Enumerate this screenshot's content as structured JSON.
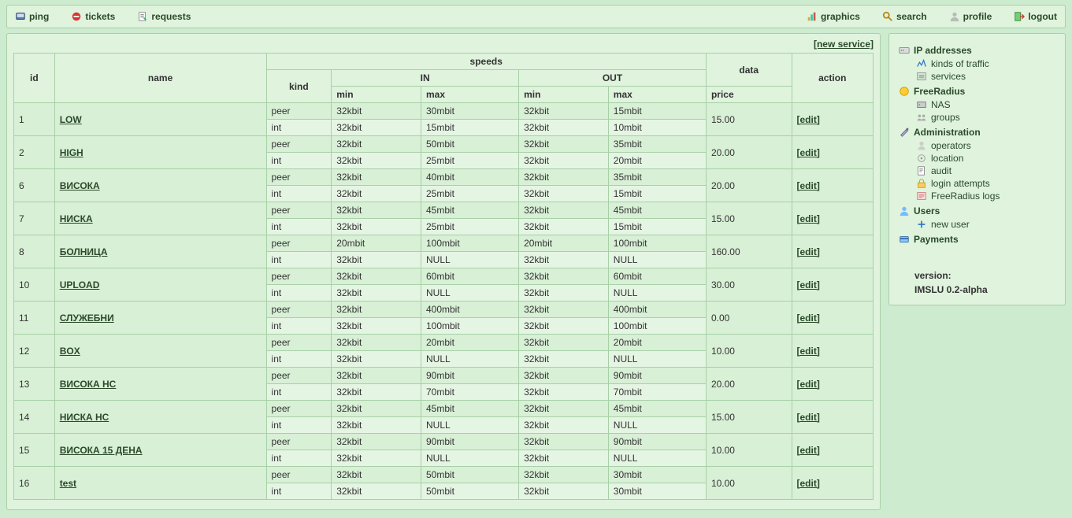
{
  "topnav": {
    "left": [
      {
        "label": "ping",
        "icon": "ping-icon"
      },
      {
        "label": "tickets",
        "icon": "tickets-icon"
      },
      {
        "label": "requests",
        "icon": "requests-icon"
      }
    ],
    "right": [
      {
        "label": "graphics",
        "icon": "graphics-icon"
      },
      {
        "label": "search",
        "icon": "search-icon"
      },
      {
        "label": "profile",
        "icon": "profile-icon"
      },
      {
        "label": "logout",
        "icon": "logout-icon"
      }
    ]
  },
  "new_service_label": "[new service]",
  "edit_label": "[edit]",
  "table": {
    "headers": {
      "id": "id",
      "name": "name",
      "speeds": "speeds",
      "kind": "kind",
      "in": "IN",
      "out": "OUT",
      "min": "min",
      "max": "max",
      "data": "data",
      "price": "price",
      "action": "action"
    },
    "kind_labels": {
      "peer": "peer",
      "int": "int"
    },
    "rows": [
      {
        "id": "1",
        "name": "LOW",
        "peer": {
          "in_min": "32kbit",
          "in_max": "30mbit",
          "out_min": "32kbit",
          "out_max": "15mbit"
        },
        "int": {
          "in_min": "32kbit",
          "in_max": "15mbit",
          "out_min": "32kbit",
          "out_max": "10mbit"
        },
        "price": "15.00"
      },
      {
        "id": "2",
        "name": "HIGH",
        "peer": {
          "in_min": "32kbit",
          "in_max": "50mbit",
          "out_min": "32kbit",
          "out_max": "35mbit"
        },
        "int": {
          "in_min": "32kbit",
          "in_max": "25mbit",
          "out_min": "32kbit",
          "out_max": "20mbit"
        },
        "price": "20.00"
      },
      {
        "id": "6",
        "name": "ВИСОКА",
        "peer": {
          "in_min": "32kbit",
          "in_max": "40mbit",
          "out_min": "32kbit",
          "out_max": "35mbit"
        },
        "int": {
          "in_min": "32kbit",
          "in_max": "25mbit",
          "out_min": "32kbit",
          "out_max": "15mbit"
        },
        "price": "20.00"
      },
      {
        "id": "7",
        "name": "НИСКА",
        "peer": {
          "in_min": "32kbit",
          "in_max": "45mbit",
          "out_min": "32kbit",
          "out_max": "45mbit"
        },
        "int": {
          "in_min": "32kbit",
          "in_max": "25mbit",
          "out_min": "32kbit",
          "out_max": "15mbit"
        },
        "price": "15.00"
      },
      {
        "id": "8",
        "name": "БОЛНИЦА",
        "peer": {
          "in_min": "20mbit",
          "in_max": "100mbit",
          "out_min": "20mbit",
          "out_max": "100mbit"
        },
        "int": {
          "in_min": "32kbit",
          "in_max": "NULL",
          "out_min": "32kbit",
          "out_max": "NULL"
        },
        "price": "160.00"
      },
      {
        "id": "10",
        "name": "UPLOAD",
        "peer": {
          "in_min": "32kbit",
          "in_max": "60mbit",
          "out_min": "32kbit",
          "out_max": "60mbit"
        },
        "int": {
          "in_min": "32kbit",
          "in_max": "NULL",
          "out_min": "32kbit",
          "out_max": "NULL"
        },
        "price": "30.00"
      },
      {
        "id": "11",
        "name": "СЛУЖЕБНИ",
        "peer": {
          "in_min": "32kbit",
          "in_max": "400mbit",
          "out_min": "32kbit",
          "out_max": "400mbit"
        },
        "int": {
          "in_min": "32kbit",
          "in_max": "100mbit",
          "out_min": "32kbit",
          "out_max": "100mbit"
        },
        "price": "0.00"
      },
      {
        "id": "12",
        "name": "BOX",
        "peer": {
          "in_min": "32kbit",
          "in_max": "20mbit",
          "out_min": "32kbit",
          "out_max": "20mbit"
        },
        "int": {
          "in_min": "32kbit",
          "in_max": "NULL",
          "out_min": "32kbit",
          "out_max": "NULL"
        },
        "price": "10.00"
      },
      {
        "id": "13",
        "name": "ВИСОКА НС",
        "peer": {
          "in_min": "32kbit",
          "in_max": "90mbit",
          "out_min": "32kbit",
          "out_max": "90mbit"
        },
        "int": {
          "in_min": "32kbit",
          "in_max": "70mbit",
          "out_min": "32kbit",
          "out_max": "70mbit"
        },
        "price": "20.00"
      },
      {
        "id": "14",
        "name": "НИСКА НС",
        "peer": {
          "in_min": "32kbit",
          "in_max": "45mbit",
          "out_min": "32kbit",
          "out_max": "45mbit"
        },
        "int": {
          "in_min": "32kbit",
          "in_max": "NULL",
          "out_min": "32kbit",
          "out_max": "NULL"
        },
        "price": "15.00"
      },
      {
        "id": "15",
        "name": "ВИСОКА 15 ДЕНА",
        "peer": {
          "in_min": "32kbit",
          "in_max": "90mbit",
          "out_min": "32kbit",
          "out_max": "90mbit"
        },
        "int": {
          "in_min": "32kbit",
          "in_max": "NULL",
          "out_min": "32kbit",
          "out_max": "NULL"
        },
        "price": "10.00"
      },
      {
        "id": "16",
        "name": "test",
        "peer": {
          "in_min": "32kbit",
          "in_max": "50mbit",
          "out_min": "32kbit",
          "out_max": "30mbit"
        },
        "int": {
          "in_min": "32kbit",
          "in_max": "50mbit",
          "out_min": "32kbit",
          "out_max": "30mbit"
        },
        "price": "10.00"
      }
    ]
  },
  "sidebar": [
    {
      "label": "IP addresses",
      "icon": "ip-icon",
      "children": [
        {
          "label": "kinds of traffic",
          "icon": "traffic-icon"
        },
        {
          "label": "services",
          "icon": "services-icon"
        }
      ]
    },
    {
      "label": "FreeRadius",
      "icon": "freeradius-icon",
      "children": [
        {
          "label": "NAS",
          "icon": "nas-icon"
        },
        {
          "label": "groups",
          "icon": "groups-icon"
        }
      ]
    },
    {
      "label": "Administration",
      "icon": "admin-icon",
      "children": [
        {
          "label": "operators",
          "icon": "operators-icon"
        },
        {
          "label": "location",
          "icon": "location-icon"
        },
        {
          "label": "audit",
          "icon": "audit-icon"
        },
        {
          "label": "login attempts",
          "icon": "login-attempts-icon"
        },
        {
          "label": "FreeRadius logs",
          "icon": "logs-icon"
        }
      ]
    },
    {
      "label": "Users",
      "icon": "users-icon",
      "children": [
        {
          "label": "new user",
          "icon": "new-user-icon"
        }
      ]
    },
    {
      "label": "Payments",
      "icon": "payments-icon",
      "children": []
    }
  ],
  "version": {
    "line1": "version:",
    "line2": "IMSLU 0.2-alpha"
  }
}
